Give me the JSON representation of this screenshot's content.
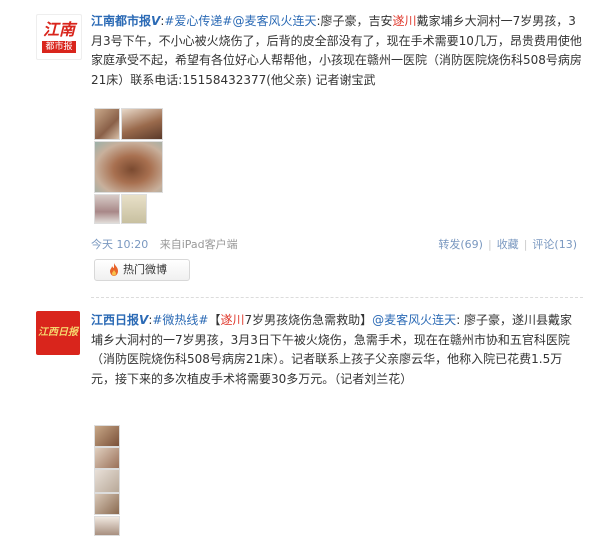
{
  "post1": {
    "avatar_text_top": "江南",
    "avatar_text_mid": "都市报",
    "author": "江南都市报",
    "verified_mark": "V",
    "colon": ":",
    "topic": "#爱心传递#",
    "mention": "@麦客风火连天",
    "text_a": ":廖子豪，吉安",
    "highlight": "遂川",
    "text_b": "戴家埔乡大洞村一7岁男孩，3月3号下午，不小心被火烧伤了，后背的皮全部没有了，现在手术需要10几万，昂贵费用使他家庭承受不起，希望有各位好心人帮帮他，小孩现在赣州一医院（消防医院烧伤科508号病房21床）联系电话:15158432377(他父亲) 记者谢宝武",
    "time": "今天 10:20",
    "source": "来自iPad客户端",
    "repost": "转发(69)",
    "favorite": "收藏",
    "comment": "评论(13)",
    "hot_label": "热门微博"
  },
  "post2": {
    "avatar_text": "江西日报",
    "author": "江西日报",
    "verified_mark": "V",
    "colon": ":",
    "topic": "#微热线#",
    "bracket_open": "【",
    "highlight": "遂川",
    "headline_rest": "7岁男孩烧伤急需救助",
    "bracket_close": "】",
    "mention": "@麦客风火连天",
    "text": ": 廖子豪，遂川县戴家埔乡大洞村的一7岁男孩，3月3日下午被火烧伤，急需手术，现在在赣州市协和五官科医院（消防医院烧伤科508号病房21床）。记者联系上孩子父亲廖云华，他称入院已花费1.5万元，接下来的多次植皮手术将需要30多万元。（记者刘兰花）"
  },
  "colors": {
    "link": "#2b6ab5",
    "highlight": "#e03a2e",
    "avatar1_bg": "#ffffff",
    "avatar1_red": "#d9251c",
    "avatar2_bg": "#d9251c",
    "avatar2_text": "#f5d76e",
    "flame": "#e8642a"
  }
}
